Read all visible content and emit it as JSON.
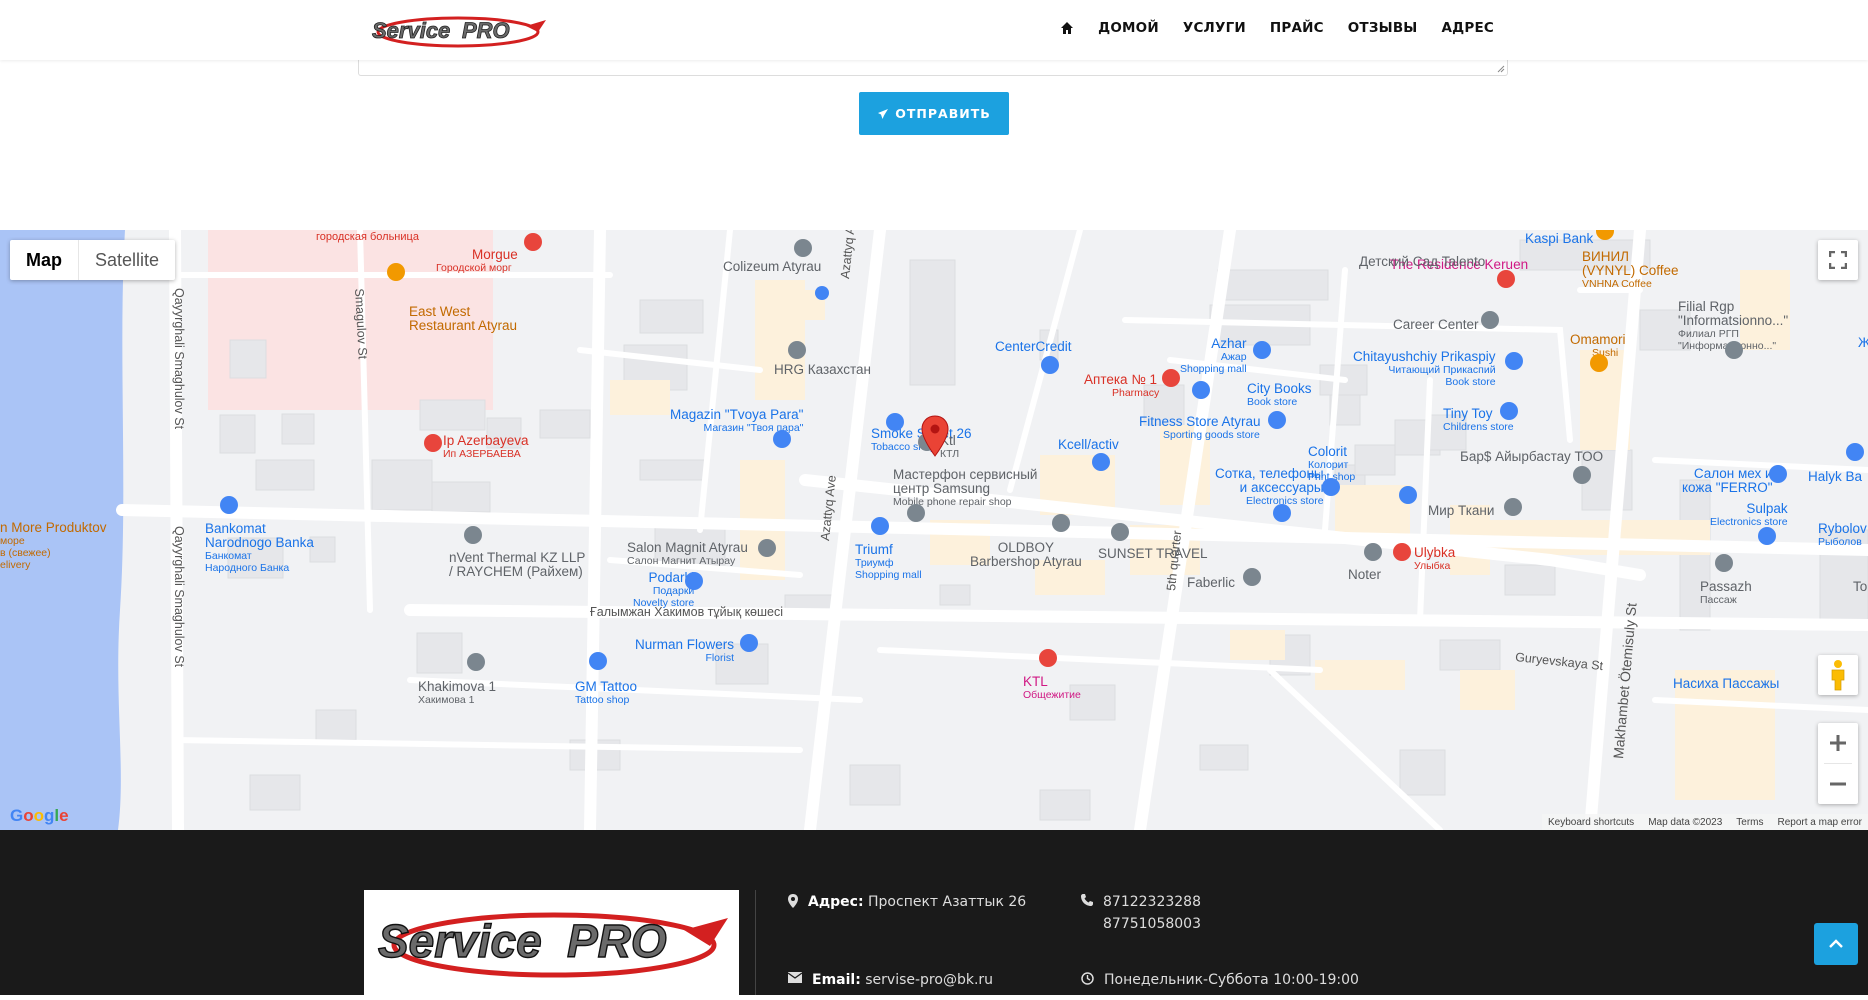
{
  "header": {
    "nav": [
      {
        "label": "ДОМОЙ"
      },
      {
        "label": "УСЛУГИ"
      },
      {
        "label": "ПРАЙС"
      },
      {
        "label": "ОТЗЫВЫ"
      },
      {
        "label": "АДРЕС"
      }
    ]
  },
  "form": {
    "send_label": "ОТПРАВИТЬ"
  },
  "map": {
    "type_map": "Map",
    "type_satellite": "Satellite",
    "footer": [
      "Keyboard shortcuts",
      "Map data ©2023",
      "Terms",
      "Report a map error"
    ],
    "streets": {
      "azattyq1": "Azattyq Ave",
      "azattyq2": "Azattyq Ave",
      "smagulov": "Smagulov St",
      "qayyrghali1": "Qayyrghali Smaghulov St",
      "qayyrghali2": "Qayyrghali Smaghulov St",
      "khakimov": "Ғалымжан Хакимов тұйық көшесі",
      "fifth": "5th quarter",
      "guryev": "Guryevskaya St",
      "makhambet": "Makhambet Ötemisuly St"
    },
    "pois": {
      "hospital": "городская больница",
      "morgue": "Morgue",
      "morgue_sub": "Городской морг",
      "eastwest1": "East West",
      "eastwest2": "Restaurant Atyrau",
      "colizeum": "Colizeum Atyrau",
      "hrg": "HRG Казахстан",
      "smoke": "Smoke Street 26",
      "smoke_sub": "Tobacco shop",
      "ktl": "Ktl",
      "ktl_sub": "КТЛ",
      "tvoya1": "Magazin \"Tvoya Para\"",
      "tvoya_sub": "Магазин \"Твоя пара\"",
      "azerbayeva": "Ip Azerbayeva",
      "azerbayeva_sub": "Ип АЗЕРБАЕВА",
      "masterfon1": "Мастерфон сервисный",
      "masterfon2": "центр Samsung",
      "masterfon_sub": "Mobile phone repair shop",
      "centercredit": "CenterCredit",
      "apteka": "Аптека № 1",
      "apteka_sub": "Pharmacy",
      "azhar": "Azhar",
      "azhar_sub1": "Ажар",
      "azhar_sub2": "Shopping mall",
      "citybooks": "City Books",
      "citybooks_sub": "Book store",
      "fitness": "Fitness Store Atyrau",
      "fitness_sub": "Sporting goods store",
      "kcell": "Kcell/activ",
      "colorit": "Colorit",
      "colorit_sub1": "Колорит",
      "colorit_sub2": "Print shop",
      "sotka1": "Сотка, телефоны",
      "sotka2": "и аксессуары",
      "sotka_sub": "Electronics store",
      "mirtkani": "Мир Ткани",
      "bars": "Бар$ Айырбастау ТОО",
      "tinytoy": "Tiny Toy",
      "tinytoy_sub": "Childrens store",
      "chitay": "Chitayushchiy Prikaspiy",
      "chitay_sub1": "Читающий Прикаспий",
      "chitay_sub2": "Book store",
      "career": "Career Center",
      "residence": "The Residence Keruen",
      "kaspi": "Kaspi Bank",
      "talento": "Детский Сад Talento",
      "vinyl1": "ВИНИЛ",
      "vinyl2": "(VYNYL) Coffee",
      "vinyl_sub": "VNHNA Coffee",
      "omamori": "Omamori",
      "omamori_sub": "Sushi",
      "filial1": "Filial Rgp",
      "filial2": "\"Informatsionno...\"",
      "filial_sub1": "Филиал РГП",
      "filial_sub2": "\"Информационно...\"",
      "salon1": "Салон мех и",
      "salon2": "кожа \"FERRO\"",
      "halyk": "Halyk Ba",
      "sulpak": "Sulpak",
      "sulpak_sub": "Electronics store",
      "rybolov": "Rybolov",
      "rybolov_sub": "Рыболов",
      "passazh": "Passazh",
      "passazh_sub": "Пассаж",
      "ulybka": "Ulybka",
      "ulybka_sub": "Улыбка",
      "noter": "Noter",
      "faberlic": "Faberlic",
      "sunset": "SUNSET TRAVEL",
      "oldboy1": "OLDBOY",
      "oldboy2": "Barbershop Atyrau",
      "triumf": "Triumf",
      "triumf_sub1": "Триумф",
      "triumf_sub2": "Shopping mall",
      "magnit": "Salon Magnit Atyrau",
      "magnit_sub": "Салон Магнит Атырау",
      "podarki": "Podarki",
      "podarki_sub1": "Подарки",
      "podarki_sub2": "Novelty store",
      "nvent1": "nVent Thermal KZ LLP",
      "nvent2": "/ RAYCHEM (Райхем)",
      "bankomat1": "Bankomat",
      "bankomat2": "Narodnogo Banka",
      "bankomat_sub1": "Банкомат",
      "bankomat_sub2": "Народного Банка",
      "nurman": "Nurman Flowers",
      "nurman_sub": "Florist",
      "gm": "GM Tattoo",
      "gm_sub": "Tattoo shop",
      "khakimova": "Khakimova 1",
      "khakimova_sub": "Хакимова 1",
      "ktl2": "KTL",
      "ktl2_sub": "Общежитие",
      "moreprod": "n More Produktov",
      "moreprod_sub1": "море",
      "moreprod_sub2": "в (свежее)",
      "moreprod_sub3": "elivery",
      "nasikha": "Насиха Пассажы",
      "toz": "To",
      "zh": "Ж"
    }
  },
  "footer": {
    "address_label": "Адрес:",
    "address_value": "Проспект Азаттык 26",
    "phone1": "87122323288",
    "phone2": "87751058003",
    "email_label": "Email:",
    "email_value": "servise-pro@bk.ru",
    "hours": "Понедельник-Суббота 10:00-19:00"
  },
  "colors": {
    "accent": "#1ca1df",
    "footer_bg": "#1a1a1a",
    "map_water": "#aac4f6",
    "marker": "#ea4335"
  }
}
